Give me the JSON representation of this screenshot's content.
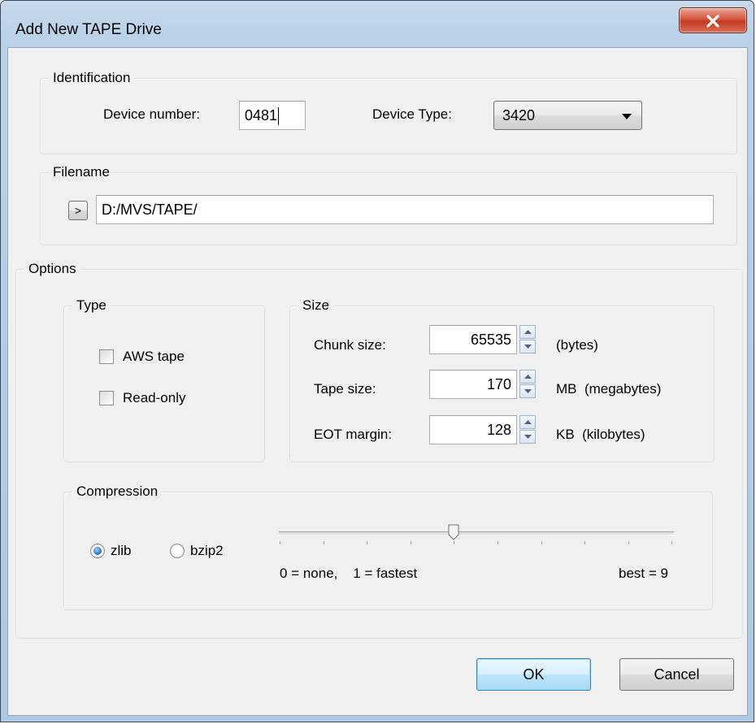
{
  "window": {
    "title": "Add New TAPE Drive",
    "close_icon": "close-icon"
  },
  "identification": {
    "legend": "Identification",
    "device_number_label": "Device number:",
    "device_number_value": "0481",
    "device_type_label": "Device Type:",
    "device_type_value": "3420"
  },
  "filename": {
    "legend": "Filename",
    "browse_label": ">",
    "path_value": "D:/MVS/TAPE/"
  },
  "options": {
    "legend": "Options",
    "type": {
      "legend": "Type",
      "aws_tape_label": "AWS tape",
      "aws_tape_checked": false,
      "read_only_label": "Read-only",
      "read_only_checked": false
    },
    "size": {
      "legend": "Size",
      "chunk_label": "Chunk size:",
      "chunk_value": "65535",
      "chunk_unit": "(bytes)",
      "tape_label": "Tape size:",
      "tape_value": "170",
      "tape_unit": "MB  (megabytes)",
      "eot_label": "EOT margin:",
      "eot_value": "128",
      "eot_unit": "KB  (kilobytes)"
    },
    "compression": {
      "legend": "Compression",
      "zlib_label": "zlib",
      "zlib_selected": true,
      "bzip2_label": "bzip2",
      "bzip2_selected": false,
      "scale_left_label": "0 = none,    1 = fastest",
      "scale_right_label": "best = 9",
      "slider_level": 4,
      "slider_min": 0,
      "slider_max": 9
    }
  },
  "buttons": {
    "ok_label": "OK",
    "cancel_label": "Cancel"
  },
  "colors": {
    "accent": "#3c7fb1",
    "close_red": "#c33a22",
    "frame": "#bcd2e8"
  }
}
